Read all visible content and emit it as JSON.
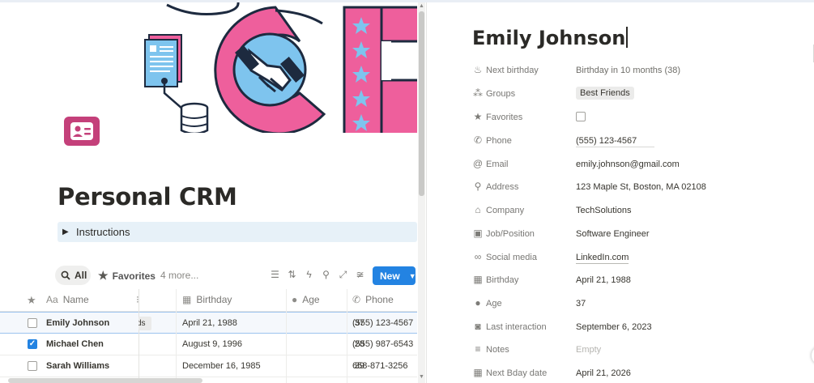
{
  "page": {
    "title": "Personal CRM",
    "instructions_label": "Instructions"
  },
  "views": {
    "all_label": "All",
    "favorites_label": "Favorites",
    "more_label": "4 more...",
    "new_label": "New"
  },
  "table": {
    "columns": [
      "Aa Name",
      "Birthday",
      "Age",
      "Phone"
    ],
    "name_header": "Name",
    "name_header_icon": "Aa",
    "rows": [
      {
        "name": "Emily Johnson",
        "birthday": "April 21, 1988",
        "age": "37",
        "phone": "(555) 123-4567",
        "checked": false,
        "group_fragment": "ds"
      },
      {
        "name": "Michael Chen",
        "birthday": "August 9, 1996",
        "age": "28",
        "phone": "(555) 987-6543",
        "checked": true
      },
      {
        "name": "Sarah Williams",
        "birthday": "December 16, 1985",
        "age": "39",
        "phone": "658-871-3256",
        "checked": false
      }
    ],
    "checked_glyph": "✓"
  },
  "record": {
    "title": "Emily Johnson",
    "properties": [
      {
        "icon": "cake-icon",
        "label": "Next birthday",
        "value": "Birthday in 10 months (38)"
      },
      {
        "icon": "groups-icon",
        "label": "Groups",
        "value": "Best Friends"
      },
      {
        "icon": "star-icon",
        "label": "Favorites",
        "value": ""
      },
      {
        "icon": "phone-icon",
        "label": "Phone",
        "value": "(555) 123-4567"
      },
      {
        "icon": "at-icon",
        "label": "Email",
        "value": "emily.johnson@gmail.com"
      },
      {
        "icon": "pin-icon",
        "label": "Address",
        "value": "123 Maple St, Boston, MA 02108"
      },
      {
        "icon": "building-icon",
        "label": "Company",
        "value": "TechSolutions"
      },
      {
        "icon": "briefcase-icon",
        "label": "Job/Position",
        "value": "Software Engineer"
      },
      {
        "icon": "link-icon",
        "label": "Social media",
        "value": "LinkedIn.com"
      },
      {
        "icon": "calendar-icon",
        "label": "Birthday",
        "value": "April 21, 1988"
      },
      {
        "icon": "person-icon",
        "label": "Age",
        "value": "37"
      },
      {
        "icon": "chat-icon",
        "label": "Last interaction",
        "value": "September 6, 2023"
      },
      {
        "icon": "notes-icon",
        "label": "Notes",
        "value": "Empty"
      },
      {
        "icon": "calendar-icon",
        "label": "Next Bday date",
        "value": "April 21, 2026"
      }
    ]
  },
  "colors": {
    "accent": "#2383e2",
    "cover_pink": "#ee5f9c",
    "cover_navy": "#1d2a3f",
    "cover_blue": "#7ec4ee",
    "page_icon": "#c4407a"
  }
}
